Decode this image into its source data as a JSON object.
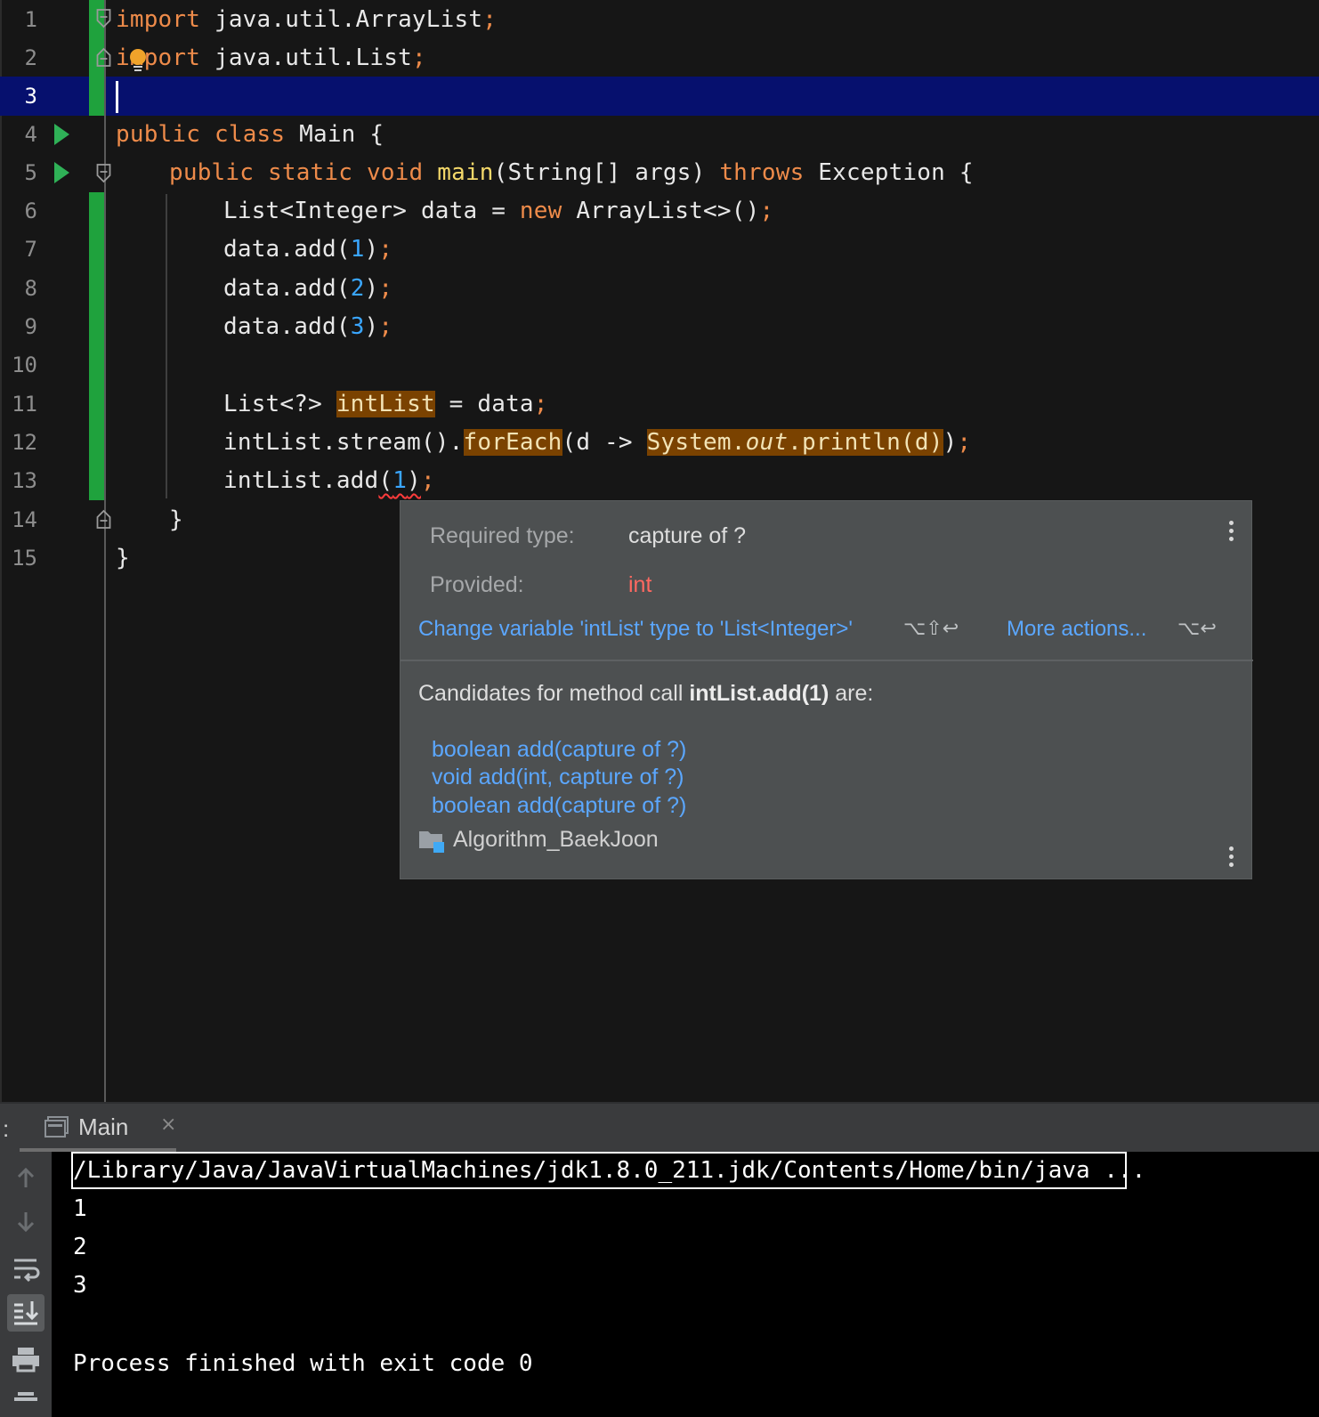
{
  "editor": {
    "current_line": 3,
    "lines": [
      {
        "n": "1"
      },
      {
        "n": "2"
      },
      {
        "n": "3"
      },
      {
        "n": "4"
      },
      {
        "n": "5"
      },
      {
        "n": "6"
      },
      {
        "n": "7"
      },
      {
        "n": "8"
      },
      {
        "n": "9"
      },
      {
        "n": "10"
      },
      {
        "n": "11"
      },
      {
        "n": "12"
      },
      {
        "n": "13"
      },
      {
        "n": "14"
      },
      {
        "n": "15"
      }
    ],
    "code": {
      "l1": {
        "kw": "import",
        "rest": " java.util.ArrayList",
        "semi": ";"
      },
      "l2": {
        "kw": "import",
        "rest": " java.util.List",
        "semi": ";"
      },
      "l4": {
        "kw1": "public",
        "kw2": "class",
        "rest": " Main {"
      },
      "l5": {
        "kw1": "public",
        "kw2": "static",
        "kw3": "void",
        "fn": "main",
        "args": "(String[] args) ",
        "kw4": "throws",
        "rest": " Exception {"
      },
      "l6": {
        "a": "List<Integer> data = ",
        "kw": "new",
        "b": " ArrayList<>()",
        "semi": ";"
      },
      "l7": {
        "a": "data.add(",
        "num": "1",
        "b": ")",
        "semi": ";"
      },
      "l8": {
        "a": "data.add(",
        "num": "2",
        "b": ")",
        "semi": ";"
      },
      "l9": {
        "a": "data.add(",
        "num": "3",
        "b": ")",
        "semi": ";"
      },
      "l11": {
        "a": "List<?> ",
        "hl": "intList",
        "b": " = data",
        "semi": ";"
      },
      "l12": {
        "a": "intList.stream().",
        "hl1": "forEach",
        "b": "(d -> ",
        "hl2a": "System.",
        "hl2b": "out",
        "hl2c": ".println(d)",
        "c": ")",
        "semi": ";"
      },
      "l13": {
        "a": "intList.add",
        "err_open": "(",
        "num": "1",
        "err_close": ")",
        "semi": ";"
      },
      "l14": {
        "rest": "}"
      },
      "l15": {
        "rest": "}"
      }
    }
  },
  "popup": {
    "required_label": "Required type:",
    "required_value": "capture of ?",
    "provided_label": "Provided:",
    "provided_value": "int",
    "fix_action": "Change variable 'intList' type to 'List<Integer>'",
    "fix_shortcut": "⌥⇧↩",
    "more_actions": "More actions...",
    "more_shortcut": "⌥↩",
    "candidates_prefix": "Candidates for method call ",
    "candidates_call": "intList.add(1)",
    "candidates_suffix": " are:",
    "candidates": [
      "boolean add(capture of ?)",
      "void add(int, capture of ?)",
      "boolean add(capture of ?)"
    ],
    "module": "Algorithm_BaekJoon"
  },
  "run_panel": {
    "colon": ":",
    "tab_label": "Main",
    "close_glyph": "×",
    "command": "/Library/Java/JavaVirtualMachines/jdk1.8.0_211.jdk/Contents/Home/bin/java ...",
    "output": [
      "1",
      "2",
      "3"
    ],
    "exit_message": "Process finished with exit code 0"
  },
  "colors": {
    "keyword": "#ee8b4a",
    "function": "#f5d96a",
    "number": "#3aa6ff",
    "link": "#5ba7ff",
    "error": "#ff6961",
    "current_line": "#06106e",
    "vcs_added": "#1fa23d"
  }
}
